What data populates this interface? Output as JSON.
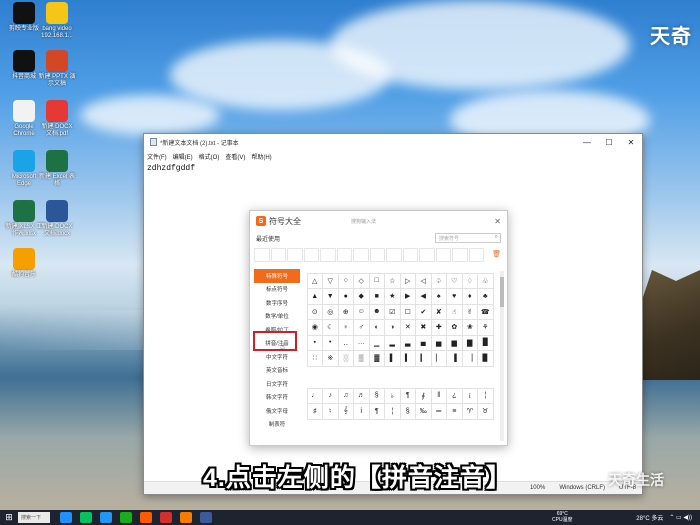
{
  "desktop": {
    "brand": "天奇",
    "icons": [
      {
        "label": "剪映专业版",
        "color": "#111111"
      },
      {
        "label": "bang video 192.168.1...",
        "color": "#f5c518"
      },
      {
        "label": "抖音商城",
        "color": "#111111"
      },
      {
        "label": "新建 PPTX 演示文稿",
        "color": "#d24726"
      },
      {
        "label": "Google Chrome",
        "color": "#f2f2f2"
      },
      {
        "label": "新建 DOCX 文档.pdf",
        "color": "#e53935"
      },
      {
        "label": "Microsoft Edge",
        "color": "#1ba3e8"
      },
      {
        "label": "新建 Excel 表格",
        "color": "#1e7145"
      },
      {
        "label": "新建 XLSX 工作表.xlsx",
        "color": "#1e7145"
      },
      {
        "label": "新建 DOCX 文档.docx",
        "color": "#2b579a"
      },
      {
        "label": "酷狗音乐",
        "color": "#f5a000"
      }
    ]
  },
  "notepad": {
    "title": "*新建文本文档 (2).txt - 记事本",
    "menu": [
      "文件(F)",
      "编辑(E)",
      "格式(O)",
      "查看(V)",
      "帮助(H)"
    ],
    "text": "zdhzdfgddf",
    "status": {
      "percent": "100%",
      "eol": "Windows (CRLF)",
      "encoding": "UTF-8"
    }
  },
  "symbol_dialog": {
    "title": "符号大全",
    "subtitle": "搜狗输入法",
    "recent_label": "最近使用",
    "search_placeholder": "搜索符号",
    "categories": [
      "特殊符号",
      "标点符号",
      "数字序号",
      "数学/单位",
      "希腊/拉丁",
      "拼音/注音",
      "中文字符",
      "英文音标",
      "日文字符",
      "韩文字符",
      "俄文字母",
      "制表符"
    ],
    "active_category": "特殊符号",
    "grid_top": [
      "△",
      "▽",
      "○",
      "◇",
      "□",
      "☆",
      "▷",
      "◁",
      "♤",
      "♡",
      "♢",
      "♧",
      "▲",
      "▼",
      "●",
      "◆",
      "■",
      "★",
      "▶",
      "◀",
      "♠",
      "♥",
      "♦",
      "♣",
      "⊙",
      "◎",
      "⊕",
      "☺",
      "☻",
      "☑",
      "☐",
      "✔",
      "✘",
      "☝",
      "✌",
      "☎",
      "◉",
      "☾",
      "♀",
      "♂",
      "◐",
      "◑",
      "✕",
      "✖",
      "✚",
      "✿",
      "❀",
      "⚘",
      "▪",
      "•",
      "‥",
      "…",
      "▁",
      "▂",
      "▃",
      "▄",
      "▅",
      "▆",
      "▇",
      "█",
      "∷",
      "※",
      "░",
      "▒",
      "▓",
      "▌",
      "▍",
      "▎",
      "▏",
      "▐",
      "▕",
      "▉"
    ],
    "grid_bottom": [
      "♩",
      "♪",
      "♫",
      "♬",
      "§",
      "♭",
      "¶",
      "∮",
      "‖",
      "¿",
      "¡",
      "¦",
      "♯",
      "♮",
      "𝄞",
      "ⅰ",
      "¶",
      "¦",
      "§",
      "‰",
      "═",
      "≡",
      "♈",
      "♉"
    ]
  },
  "caption": "4.点击左侧的【拼音注音】",
  "watermark": "天奇生活",
  "taskbar": {
    "search_text": "搜索一下",
    "weather_temp": "69°C",
    "weather_desc": "CPU温度",
    "temp": "28°C 多云",
    "apps": [
      "#1e90ff",
      "#07c160",
      "#2196f3",
      "#1aad19",
      "#ff5a00",
      "#d32f2f",
      "#f57c00",
      "#3c5a99"
    ]
  }
}
